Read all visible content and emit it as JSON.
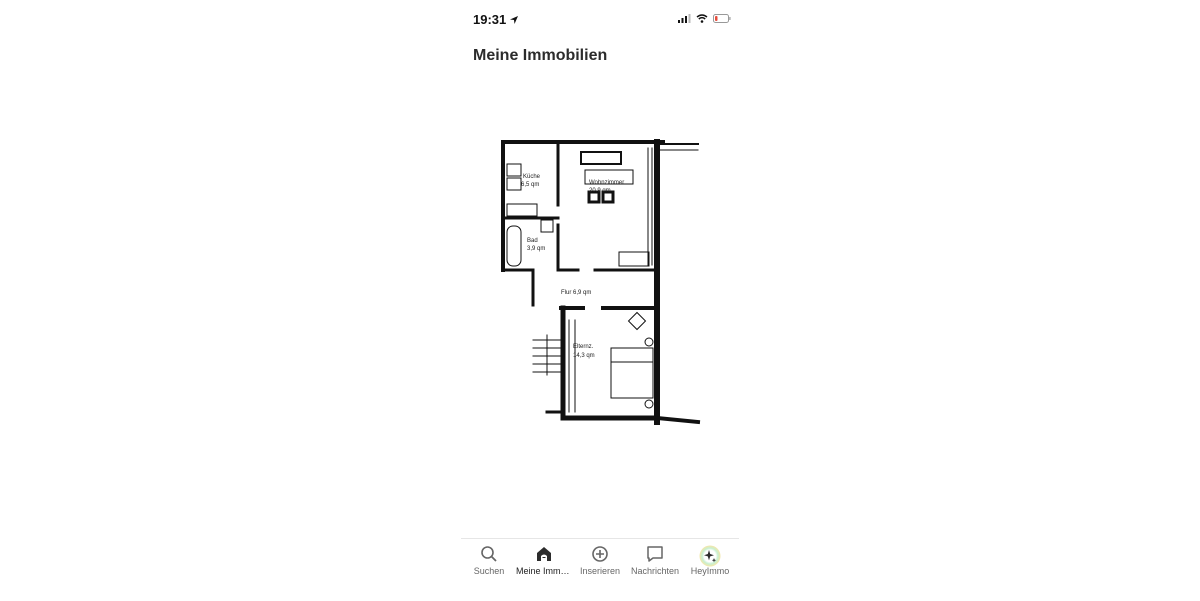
{
  "status_bar": {
    "time": "19:31",
    "icons": [
      "location-arrow-icon",
      "signal-icon",
      "wifi-icon",
      "battery-icon"
    ],
    "battery_color": "#e74c3c"
  },
  "header": {
    "title": "Meine Immobilien"
  },
  "floorplan": {
    "rooms": [
      {
        "name": "Küche",
        "area": "6,5 qm"
      },
      {
        "name": "Wohnzimmer",
        "area": "20,9 qm"
      },
      {
        "name": "Bad",
        "area": "3,9 qm"
      },
      {
        "name": "Flur",
        "area": "6,9 qm"
      },
      {
        "name": "Elternz.",
        "area": "14,3 qm"
      }
    ]
  },
  "tabbar": {
    "items": [
      {
        "label": "Suchen",
        "icon": "search-icon"
      },
      {
        "label": "Meine Immobilien",
        "icon": "home-icon",
        "active": true
      },
      {
        "label": "Inserieren",
        "icon": "plus-circle-icon"
      },
      {
        "label": "Nachrichten",
        "icon": "message-icon"
      },
      {
        "label": "HeyImmo",
        "icon": "sparkle-icon"
      }
    ],
    "accent_color": "#2c2c2c"
  }
}
